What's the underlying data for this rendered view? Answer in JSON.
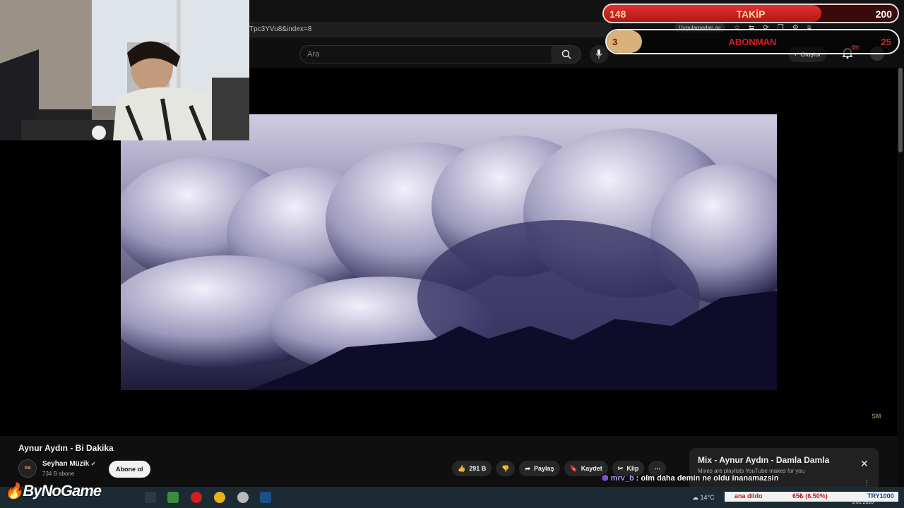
{
  "browser": {
    "url_fragment": "Tpc3YVu8&index=8",
    "apps_label": "Uygulamadan aç"
  },
  "youtube": {
    "search_placeholder": "Ara",
    "create_label": "Oluştur",
    "notif_badge": "9+"
  },
  "overlay": {
    "follow": {
      "current": "148",
      "label": "TAKİP",
      "goal": "200",
      "progress": 0.74
    },
    "subs": {
      "current": "3",
      "label": "ABONMAN",
      "goal": "25",
      "progress": 0.12
    }
  },
  "video": {
    "title": "Aynur Aydın - Bi Dakika",
    "watermark": "SM"
  },
  "channel": {
    "avatar_text": "SM",
    "name": "Seyhan Müzik",
    "verified": "✔",
    "subscribers": "734 B abone",
    "subscribe_label": "Abone ol"
  },
  "actions": {
    "likes": "291 B",
    "share": "Paylaş",
    "save": "Kaydet",
    "clip": "Klip",
    "more": "⋯"
  },
  "mix": {
    "title": "Mix - Aynur Aydın - Damla Damla",
    "subtitle": "Mixes are playlists YouTube makes for you"
  },
  "chat": {
    "user": "mrv_b",
    "message": ": olm daha demin ne oldu inanamazsin"
  },
  "taskbar": {
    "logo": "ByNoGame",
    "temperature": "14°C",
    "ticker_text": "ana dildo",
    "ticker_change": "65₺ (6.50%)",
    "ticker_pair": "TRY1000",
    "date": "5.01.2026"
  }
}
